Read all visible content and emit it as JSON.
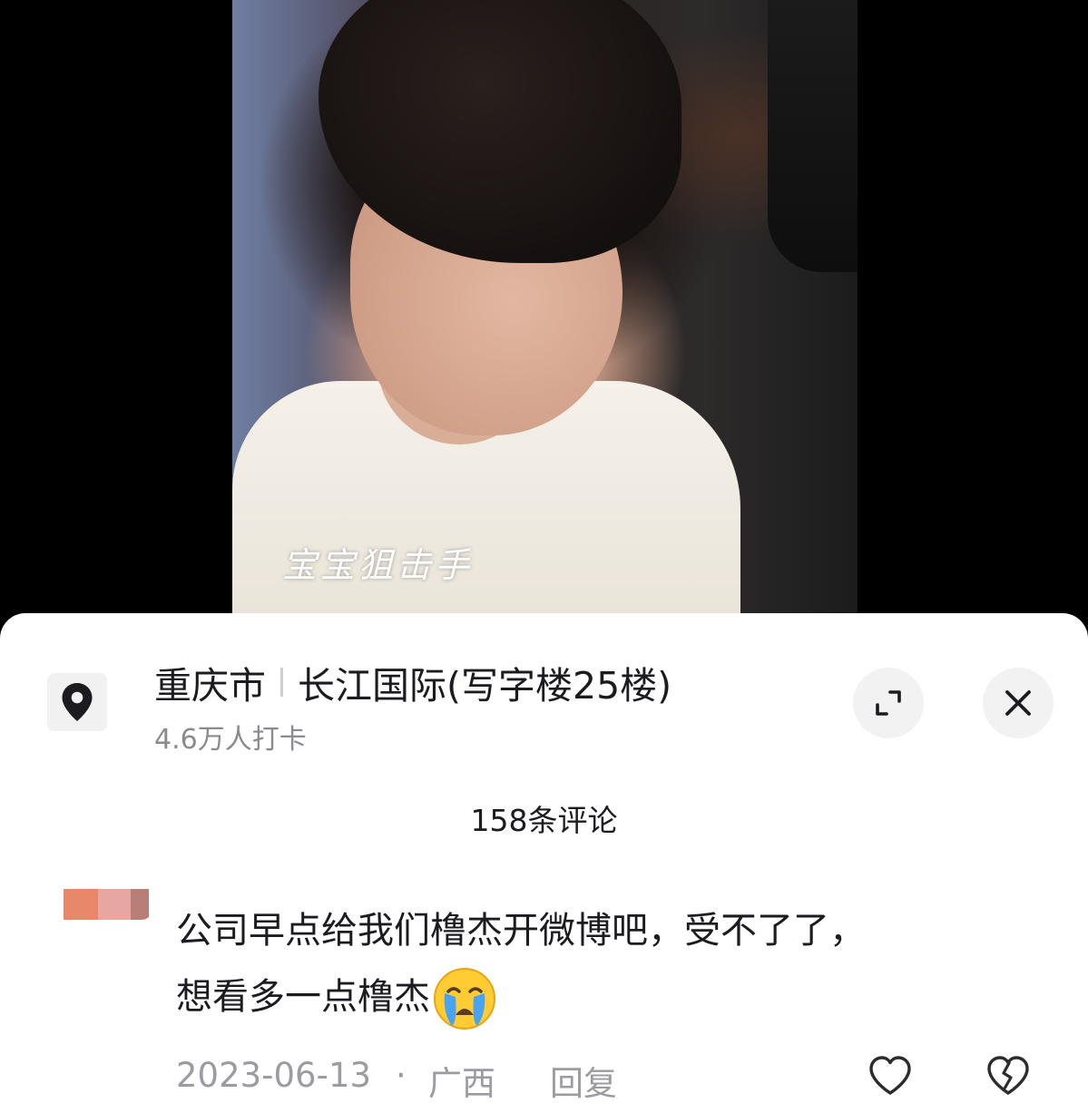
{
  "video": {
    "watermark_text": "宝宝狙击手"
  },
  "location": {
    "icon": "location-pin-icon",
    "city": "重庆市",
    "place": "长江国际(写字楼25楼)",
    "checkins": "4.6万人打卡"
  },
  "header_buttons": {
    "expand_icon": "expand-icon",
    "close_icon": "close-icon"
  },
  "comments": {
    "count_label": "158条评论",
    "items": [
      {
        "avatar_colors": [
          "#e9876b",
          "#e8a6a1",
          "#b97f76"
        ],
        "line1": "公司早点给我们橹杰开微博吧，受不了了，",
        "line2": "想看多一点橹杰",
        "emoji": "crying-face-emoji",
        "date": "2023-06-13",
        "separator": "·",
        "region": "广西",
        "reply_label": "回复",
        "like_icon": "heart-icon",
        "dislike_icon": "broken-heart-icon"
      }
    ]
  }
}
